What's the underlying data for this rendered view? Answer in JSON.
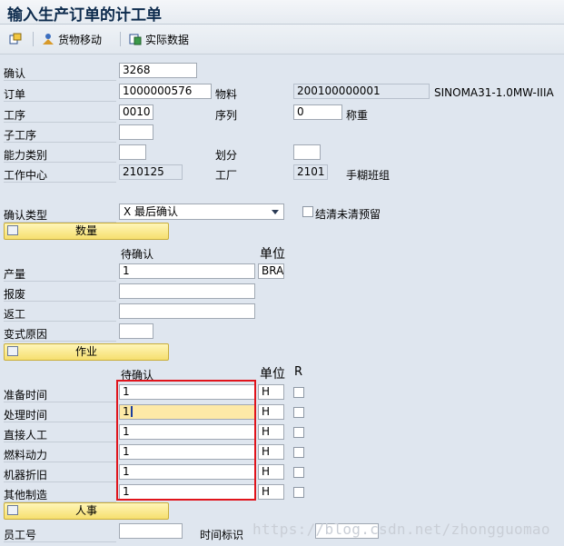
{
  "window": {
    "title": "输入生产订单的计工单"
  },
  "toolbar": {
    "goods_movement": "货物移动",
    "actual_data": "实际数据"
  },
  "header": {
    "confirmation_label": "确认",
    "confirmation_value": "3268",
    "order_label": "订单",
    "order_value": "1000000576",
    "material_label": "物料",
    "material_value": "200100000001",
    "material_desc": "SINOMA31-1.0MW-IIIA",
    "operation_label": "工序",
    "operation_value": "0010",
    "sequence_label": "序列",
    "sequence_value": "0",
    "sequence_text": "称重",
    "suboperation_label": "子工序",
    "suboperation_value": "",
    "capacity_label": "能力类别",
    "capacity_value": "",
    "split_label": "划分",
    "split_value": "",
    "workcenter_label": "工作中心",
    "workcenter_value": "210125",
    "plant_label": "工厂",
    "plant_value": "2101",
    "plant_text": "手糊班组"
  },
  "confirm_type": {
    "label": "确认类型",
    "value": "X 最后确认",
    "clear_reservation_label": "结清未清预留"
  },
  "quantities": {
    "section_label": "数量",
    "col_to_confirm": "待确认",
    "col_unit": "单位",
    "rows": [
      {
        "label": "产量",
        "value": "1",
        "unit": "BRA"
      },
      {
        "label": "报废",
        "value": "",
        "unit": ""
      },
      {
        "label": "返工",
        "value": "",
        "unit": ""
      }
    ],
    "variance_label": "变式原因",
    "variance_value": ""
  },
  "activities": {
    "section_label": "作业",
    "col_to_confirm": "待确认",
    "col_unit": "单位",
    "col_r": "R",
    "rows": [
      {
        "label": "准备时间",
        "value": "1",
        "unit": "H"
      },
      {
        "label": "处理时间",
        "value": "1",
        "unit": "H"
      },
      {
        "label": "直接人工",
        "value": "1",
        "unit": "H"
      },
      {
        "label": "燃料动力",
        "value": "1",
        "unit": "H"
      },
      {
        "label": "机器折旧",
        "value": "1",
        "unit": "H"
      },
      {
        "label": "其他制造",
        "value": "1",
        "unit": "H"
      }
    ]
  },
  "personnel": {
    "section_label": "人事",
    "employee_label": "员工号",
    "employee_value": "",
    "time_id_label": "时间标识",
    "time_id_value": ""
  },
  "watermark": "https://blog.csdn.net/zhongguomao",
  "colors": {
    "highlight": "#e0141c",
    "section_button": "#f6df6f",
    "focused_field": "#fde9a7"
  }
}
